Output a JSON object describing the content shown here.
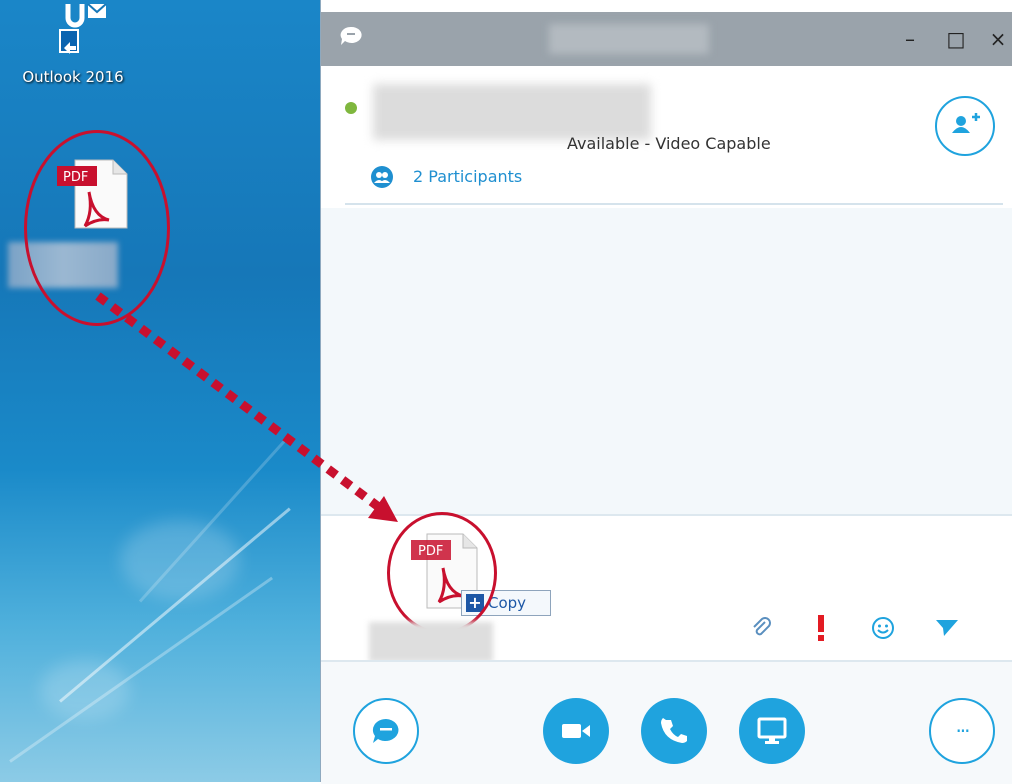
{
  "desktop": {
    "outlook_label": "Outlook 2016",
    "pdf_icon_label": "PDF"
  },
  "window": {
    "controls": {
      "minimize": "–",
      "maximize": "□",
      "close": "×"
    }
  },
  "contact": {
    "status": "Available - Video Capable",
    "participants": "2 Participants",
    "presence_color": "#7fb73e"
  },
  "compose": {
    "drag_file_label": "PDF",
    "copy_tooltip": "Copy",
    "copy_plus": "+"
  },
  "toolbar": {
    "icons": [
      "paperclip-icon",
      "important-icon",
      "emoticon-icon",
      "send-icon"
    ]
  },
  "bottom_bar": {
    "buttons": [
      "im-button",
      "video-button",
      "call-button",
      "present-button",
      "more-options-button"
    ],
    "more_label": "···"
  },
  "colors": {
    "accent": "#1fa3de",
    "annotation_red": "#c8102e",
    "titlebar": "#9aa3ab"
  }
}
